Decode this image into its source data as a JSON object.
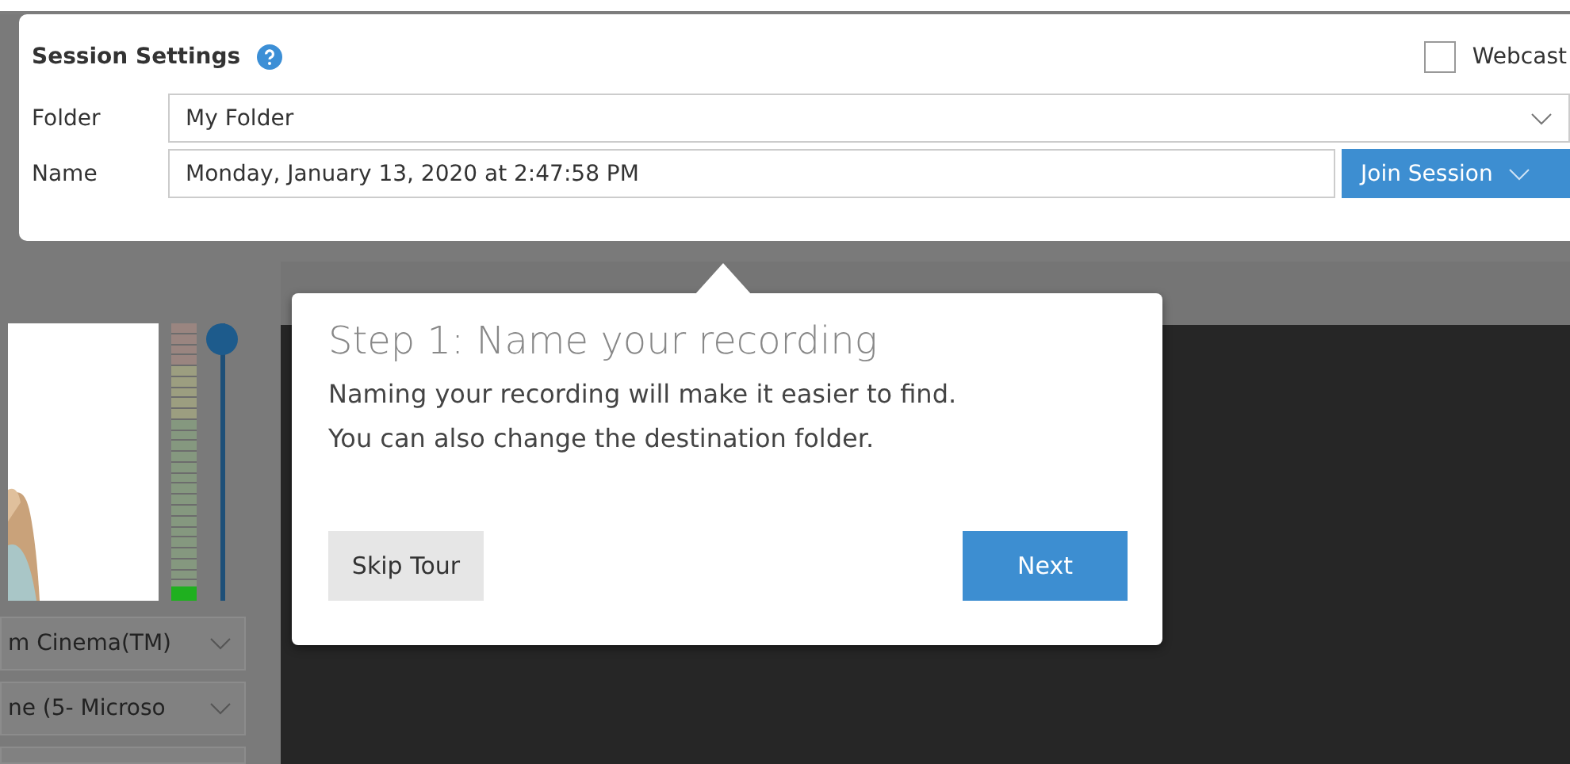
{
  "session_settings": {
    "title": "Session Settings",
    "webcast": {
      "label": "Webcast",
      "checked": false
    },
    "folder": {
      "label": "Folder",
      "value": "My Folder"
    },
    "name": {
      "label": "Name",
      "value": "Monday, January 13, 2020 at 2:47:58 PM"
    },
    "join_button": "Join Session"
  },
  "sources": {
    "audio_meter": {
      "level": 0.05
    },
    "volume_slider": {
      "level": 1
    },
    "devices": [
      {
        "value": "m Cinema(TM)"
      },
      {
        "value": "ne (5- Microso"
      }
    ]
  },
  "tour_popup": {
    "title": "Step 1: Name your recording",
    "lines": [
      "Naming your recording will make it easier to find.",
      "You can also change the destination folder."
    ],
    "skip_button": "Skip Tour",
    "next_button": "Next"
  }
}
